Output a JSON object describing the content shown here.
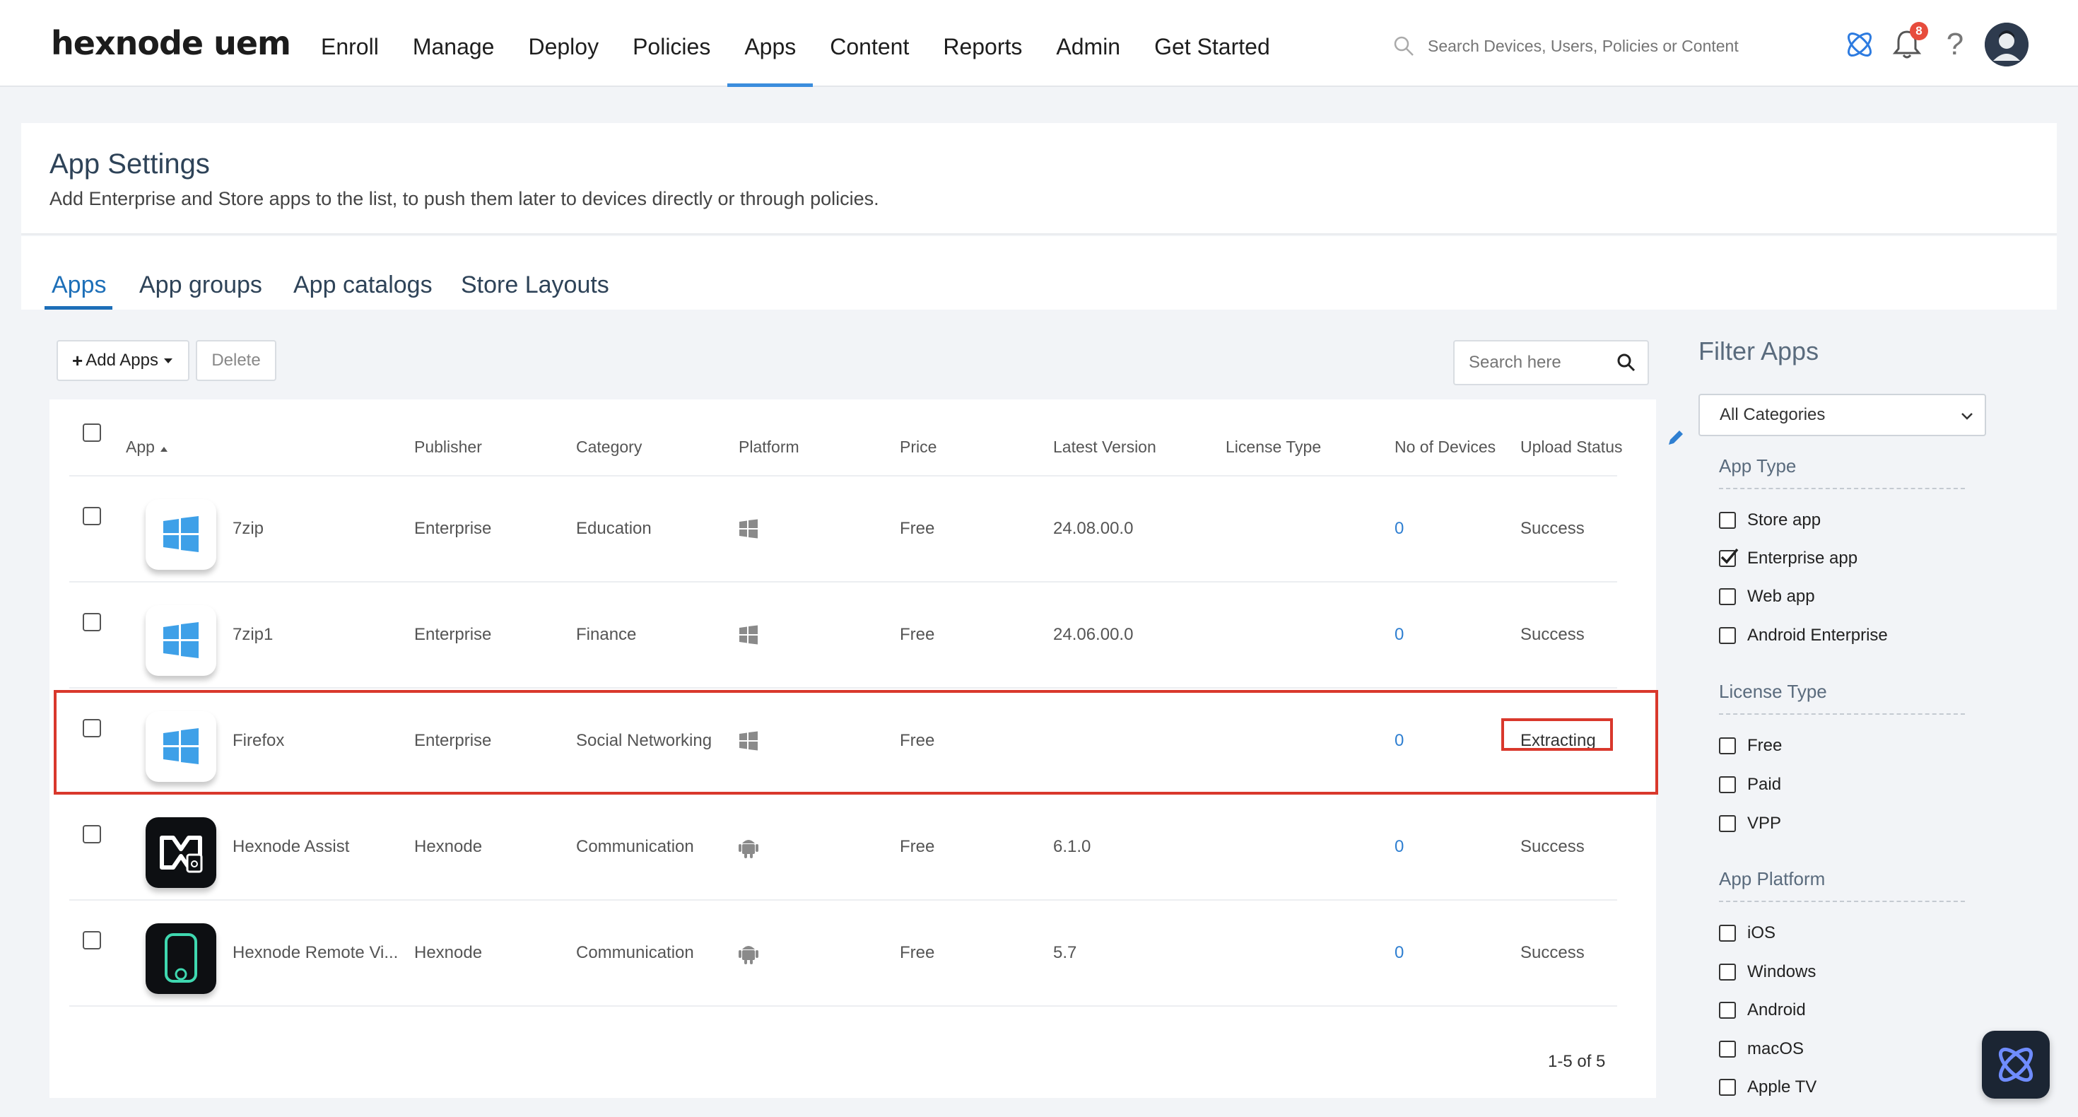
{
  "brand": {
    "logo_text": "hexnode uem",
    "accent": "#1d6fb8",
    "highlight": "#d9382c"
  },
  "nav": {
    "items": [
      "Enroll",
      "Manage",
      "Deploy",
      "Policies",
      "Apps",
      "Content",
      "Reports",
      "Admin",
      "Get Started"
    ],
    "active": "Apps",
    "search_placeholder": "Search Devices, Users, Policies or Content",
    "notification_count": "8",
    "help": "?"
  },
  "header": {
    "title": "App Settings",
    "description": "Add Enterprise and Store apps to the list, to push them later to devices directly or through policies."
  },
  "tabs": [
    "Apps",
    "App groups",
    "App catalogs",
    "Store Layouts"
  ],
  "toolbar": {
    "add_label": "Add Apps",
    "delete_label": "Delete",
    "search_placeholder": "Search here"
  },
  "table": {
    "columns": [
      "App",
      "Publisher",
      "Category",
      "Platform",
      "Price",
      "Latest Version",
      "License Type",
      "No of Devices",
      "Upload Status"
    ],
    "rows": [
      {
        "name": "7zip",
        "publisher": "Enterprise",
        "category": "Education",
        "platform": "windows-icon",
        "price": "Free",
        "version": "24.08.00.0",
        "license": "",
        "devices": "0",
        "status": "Success",
        "icon": "windows-logo"
      },
      {
        "name": "7zip1",
        "publisher": "Enterprise",
        "category": "Finance",
        "platform": "windows-icon",
        "price": "Free",
        "version": "24.06.00.0",
        "license": "",
        "devices": "0",
        "status": "Success",
        "icon": "windows-logo"
      },
      {
        "name": "Firefox",
        "publisher": "Enterprise",
        "category": "Social Networking",
        "platform": "windows-icon",
        "price": "Free",
        "version": "",
        "license": "",
        "devices": "0",
        "status": "Extracting",
        "icon": "windows-logo"
      },
      {
        "name": "Hexnode Assist",
        "publisher": "Hexnode",
        "category": "Communication",
        "platform": "android-icon",
        "price": "Free",
        "version": "6.1.0",
        "license": "",
        "devices": "0",
        "status": "Success",
        "icon": "hexnode-assist-logo"
      },
      {
        "name": "Hexnode Remote Vi...",
        "publisher": "Hexnode",
        "category": "Communication",
        "platform": "android-icon",
        "price": "Free",
        "version": "5.7",
        "license": "",
        "devices": "0",
        "status": "Success",
        "icon": "hexnode-remote-logo"
      }
    ],
    "pagination": "1-5 of 5"
  },
  "filter": {
    "title": "Filter Apps",
    "category_select": "All Categories",
    "sections": [
      {
        "title": "App Type",
        "options": [
          {
            "label": "Store app",
            "checked": false
          },
          {
            "label": "Enterprise app",
            "checked": true
          },
          {
            "label": "Web app",
            "checked": false
          },
          {
            "label": "Android Enterprise",
            "checked": false
          }
        ]
      },
      {
        "title": "License Type",
        "options": [
          {
            "label": "Free",
            "checked": false
          },
          {
            "label": "Paid",
            "checked": false
          },
          {
            "label": "VPP",
            "checked": false
          }
        ]
      },
      {
        "title": "App Platform",
        "options": [
          {
            "label": "iOS",
            "checked": false
          },
          {
            "label": "Windows",
            "checked": false
          },
          {
            "label": "Android",
            "checked": false
          },
          {
            "label": "macOS",
            "checked": false
          },
          {
            "label": "Apple TV",
            "checked": false
          }
        ]
      }
    ]
  }
}
